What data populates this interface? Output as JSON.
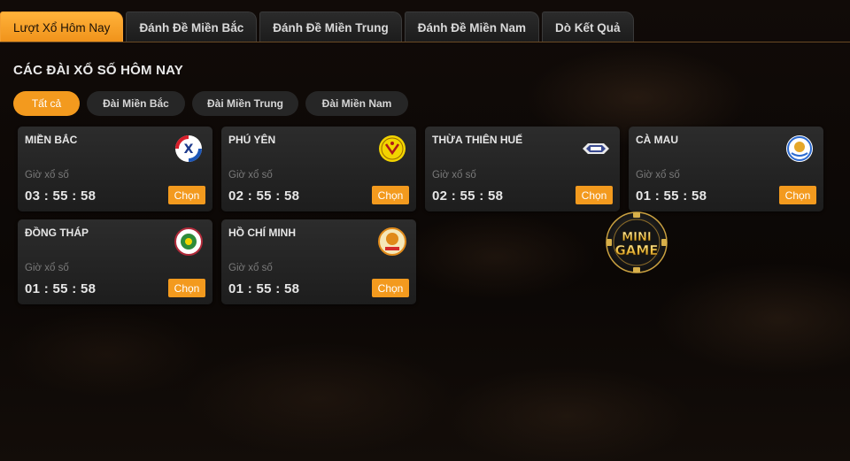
{
  "tabs": [
    {
      "label": "Lượt Xổ Hôm Nay",
      "active": true
    },
    {
      "label": "Đánh Đề Miền Bắc",
      "active": false
    },
    {
      "label": "Đánh Đề Miền Trung",
      "active": false
    },
    {
      "label": "Đánh Đề Miền Nam",
      "active": false
    },
    {
      "label": "Dò Kết Quả",
      "active": false
    }
  ],
  "section_title": "CÁC ĐÀI XỔ SỐ HÔM NAY",
  "filters": [
    {
      "label": "Tất cả",
      "active": true
    },
    {
      "label": "Đài Miền Bắc",
      "active": false
    },
    {
      "label": "Đài Miền Trung",
      "active": false
    },
    {
      "label": "Đài Miền Nam",
      "active": false
    }
  ],
  "cards": [
    {
      "name": "MIỀN BẮC",
      "label": "Giờ xổ số",
      "time": "03 : 55 : 58",
      "button": "Chọn",
      "logo_icon": "xoso-mienbac-logo-icon"
    },
    {
      "name": "PHÚ YÊN",
      "label": "Giờ xổ số",
      "time": "02 : 55 : 58",
      "button": "Chọn",
      "logo_icon": "phu-yen-logo-icon"
    },
    {
      "name": "THỪA THIÊN HUẾ",
      "label": "Giờ xổ số",
      "time": "02 : 55 : 58",
      "button": "Chọn",
      "logo_icon": "thua-thien-hue-logo-icon"
    },
    {
      "name": "CÀ MAU",
      "label": "Giờ xổ số",
      "time": "01 : 55 : 58",
      "button": "Chọn",
      "logo_icon": "ca-mau-logo-icon"
    },
    {
      "name": "ĐỒNG THÁP",
      "label": "Giờ xổ số",
      "time": "01 : 55 : 58",
      "button": "Chọn",
      "logo_icon": "dong-thap-logo-icon"
    },
    {
      "name": "HỒ CHÍ MINH",
      "label": "Giờ xổ số",
      "time": "01 : 55 : 58",
      "button": "Chọn",
      "logo_icon": "ho-chi-minh-logo-icon"
    }
  ],
  "mini_game": {
    "line1": "MINI",
    "line2": "GAME"
  },
  "colors": {
    "accent": "#f39a1e",
    "card_bg": "#262626",
    "background": "#0c0806"
  }
}
